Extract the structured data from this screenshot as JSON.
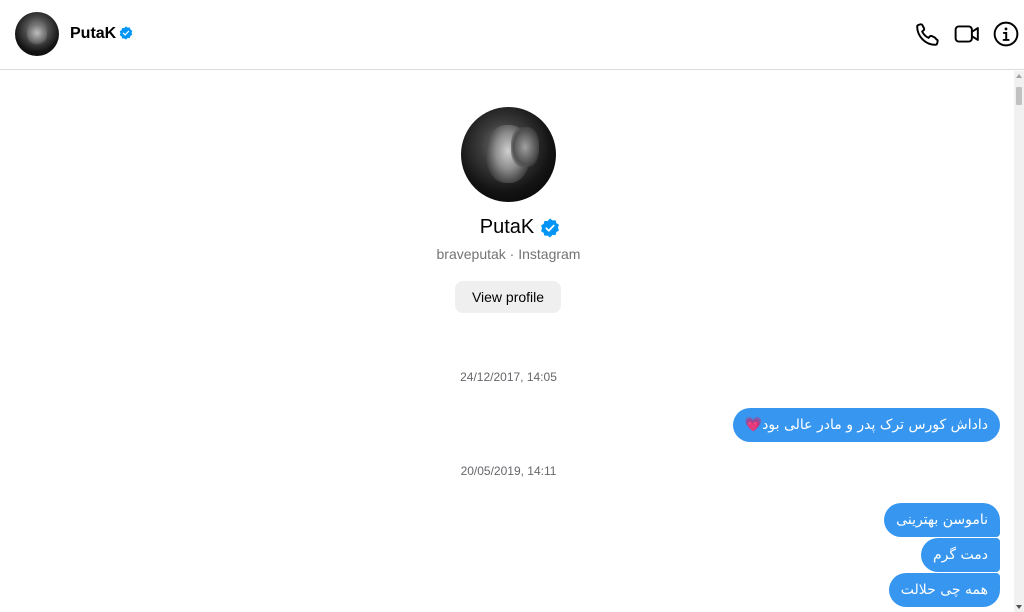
{
  "header": {
    "name": "PutaK",
    "icons": [
      "phone-icon",
      "video-call-icon",
      "info-icon"
    ]
  },
  "profile": {
    "name": "PutaK",
    "subtitle": "braveputak · Instagram",
    "view_profile_label": "View profile"
  },
  "messages": [
    {
      "timestamp": "24/12/2017, 14:05",
      "texts": [
        "داداش کورس ترک پدر و مادر عالی بود💗"
      ]
    },
    {
      "timestamp": "20/05/2019, 14:11",
      "texts": [
        "ناموسن بهترینی",
        "دمت گرم",
        "همه چی حلالت"
      ]
    }
  ],
  "colors": {
    "accent": "#3797f0",
    "verified": "#0095f6",
    "timestamp": "#65676b"
  }
}
